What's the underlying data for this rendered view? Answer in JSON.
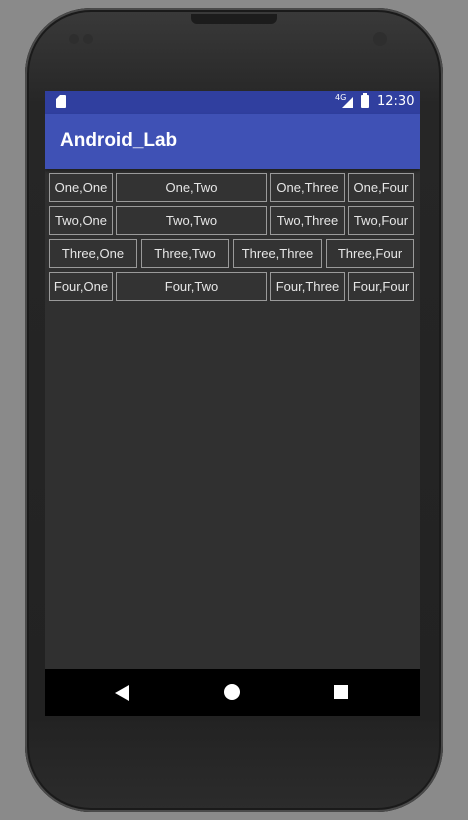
{
  "status_bar": {
    "network": "4G",
    "time": "12:30",
    "icons": [
      "sd-card-icon",
      "signal-icon",
      "battery-icon"
    ]
  },
  "app_bar": {
    "title": "Android_Lab"
  },
  "grid": {
    "rows": [
      [
        "One,One",
        "One,Two",
        "One,Three",
        "One,Four"
      ],
      [
        "Two,One",
        "Two,Two",
        "Two,Three",
        "Two,Four"
      ],
      [
        "Three,One",
        "Three,Two",
        "Three,Three",
        "Three,Four"
      ],
      [
        "Four,One",
        "Four,Two",
        "Four,Three",
        "Four,Four"
      ]
    ]
  },
  "nav_bar": {
    "icons": [
      "back-icon",
      "home-icon",
      "recents-icon"
    ]
  },
  "colors": {
    "status_bar": "#303f9f",
    "app_bar": "#3f51b5",
    "screen_background": "#303030"
  }
}
